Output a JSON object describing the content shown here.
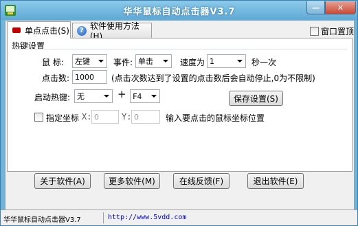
{
  "window": {
    "title": "华华鼠标自动点击器V3.7",
    "minimize_glyph": "—",
    "close_glyph": "✕"
  },
  "tabs": [
    {
      "label": "单点点击(S)",
      "icon": "red-mouse-icon",
      "active": true
    },
    {
      "label": "软件使用方法(H)",
      "icon": "help-icon",
      "active": false
    }
  ],
  "topmost": {
    "label": "窗口置顶",
    "checked": false
  },
  "hotkey_group": {
    "title": "热键设置"
  },
  "row_mouse": {
    "mouse_label": "鼠  标:",
    "mouse_value": "左键",
    "event_label": "事件:",
    "event_value": "单击",
    "speed_label": "速度为",
    "speed_value": "1",
    "speed_unit": "秒一次"
  },
  "row_clicks": {
    "label": "点击数:",
    "value": "1000",
    "hint": "(点击次数达到了设置的点击数后会自动停止,0为不限制)"
  },
  "row_hotkey": {
    "label": "启动热键:",
    "modifier_value": "无",
    "plus": "+",
    "key_value": "F4",
    "save_button": "保存设置(S)"
  },
  "row_coords": {
    "checkbox_label": "指定坐标",
    "x_label": "X:",
    "x_value": "0",
    "y_label": "Y:",
    "y_value": "0",
    "hint": "输入要点击的鼠标坐标位置"
  },
  "bottom_buttons": {
    "about": "关于软件(A)",
    "more": "更多软件(M)",
    "feedback": "在线反馈(F)",
    "exit": "退出软件(E)"
  },
  "status": {
    "app": "华华鼠标自动点击器V3.7",
    "url": "http://www.5vdd.com"
  },
  "colors": {
    "titlebar": "#6fb3d8",
    "close_button": "#c74a36",
    "tab_icon_red": "#c00000",
    "status_link": "#0000c0"
  }
}
